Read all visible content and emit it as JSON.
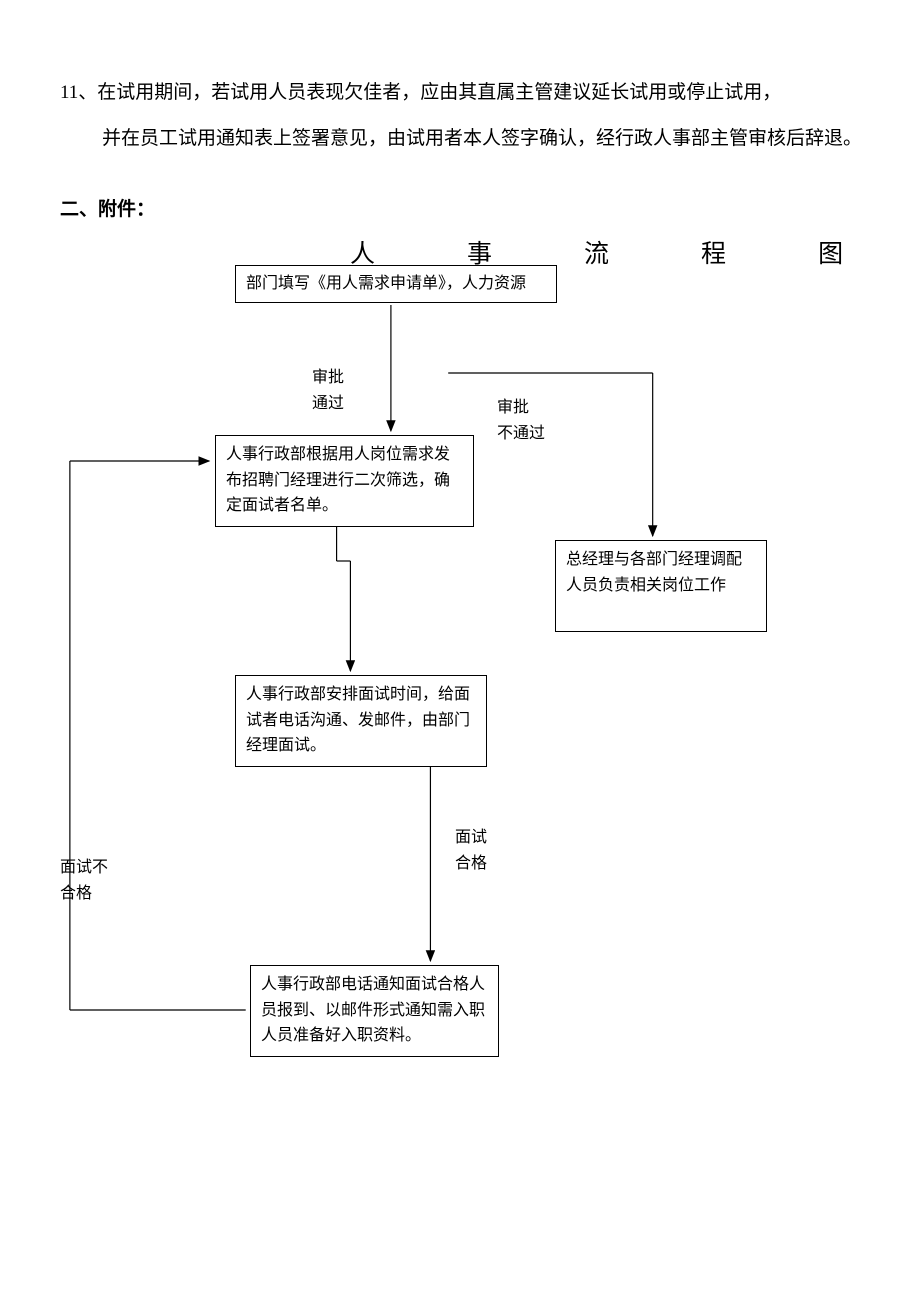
{
  "paragraph": {
    "number": "11、",
    "text_line1": "在试用期间，若试用人员表现欠佳者，应由其直属主管建议延长试用或停止试用，",
    "text_rest": "并在员工试用通知表上签署意见，由试用者本人签字确认，经行政人事部主管审核后辞退。"
  },
  "section_heading": "二、附件：",
  "flowchart": {
    "title_chars": [
      "人",
      "事",
      "流",
      "程",
      "图"
    ],
    "title_text": "人事流程图",
    "boxes": {
      "b1": "部门填写《用人需求申请单》，人力资源",
      "b2": "人事行政部根据用人岗位需求发布招聘门经理进行二次筛选，确定面试者名单。",
      "b3": "总经理与各部门经理调配人员负责相关岗位工作",
      "b4": "人事行政部安排面试时间，给面试者电话沟通、发邮件，由部门经理面试。",
      "b5": "人事行政部电话通知面试合格人员报到、以邮件形式通知需入职人员准备好入职资料。"
    },
    "labels": {
      "approve_pass": "审批\n通过",
      "approve_fail": "审批\n不通过",
      "interview_pass": "面试\n合格",
      "interview_fail": "面试不\n合格"
    }
  }
}
